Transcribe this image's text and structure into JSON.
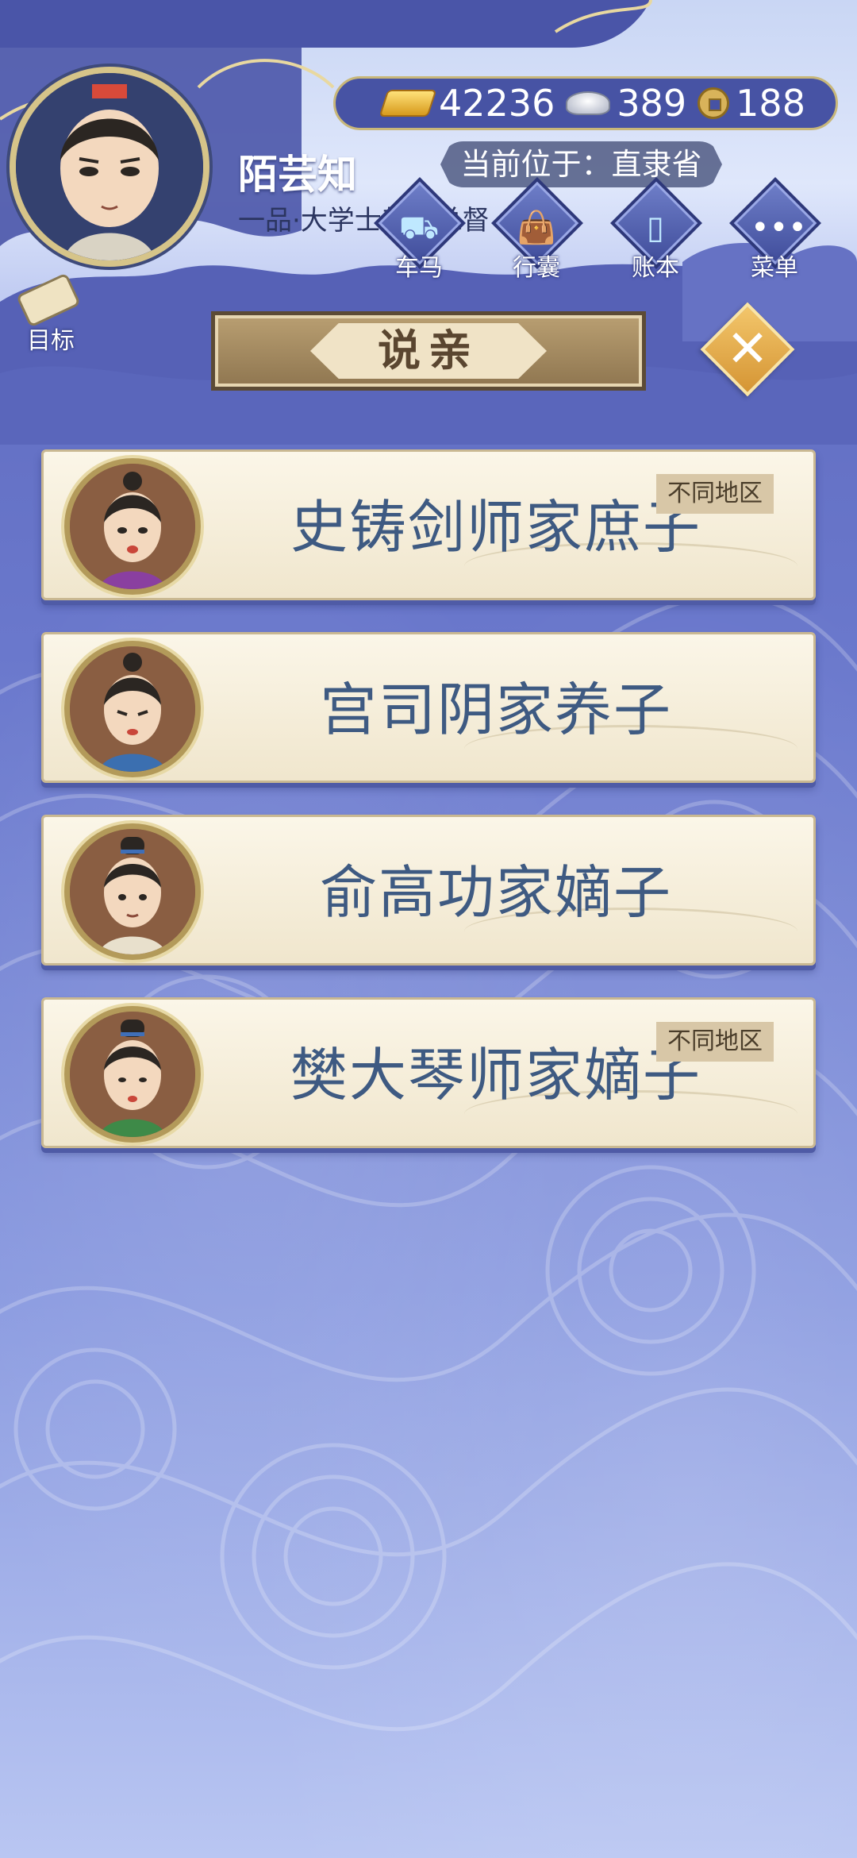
{
  "player": {
    "name": "陌芸知",
    "title": "一品·大学士都隶总督",
    "location_label": "当前位于：直隶省"
  },
  "currency": {
    "gold": "42236",
    "silver": "389",
    "copper": "188"
  },
  "toolbar": {
    "items": [
      {
        "label": "车马",
        "icon": "carriage-icon"
      },
      {
        "label": "行囊",
        "icon": "bag-icon"
      },
      {
        "label": "账本",
        "icon": "ledger-icon"
      },
      {
        "label": "菜单",
        "icon": "menu-icon"
      }
    ]
  },
  "goal": {
    "label": "目标"
  },
  "panel": {
    "title": "说亲"
  },
  "candidates": [
    {
      "name": "史铸剑师家庶子",
      "tag": "不同地区"
    },
    {
      "name": "宫司阴家养子",
      "tag": ""
    },
    {
      "name": "俞高功家嫡子",
      "tag": ""
    },
    {
      "name": "樊大琴师家嫡子",
      "tag": "不同地区"
    }
  ],
  "colors": {
    "background": "#6a78cc",
    "card": "#fbf6e8",
    "name_text": "#3e5a82",
    "accent_gold": "#d6c489"
  }
}
